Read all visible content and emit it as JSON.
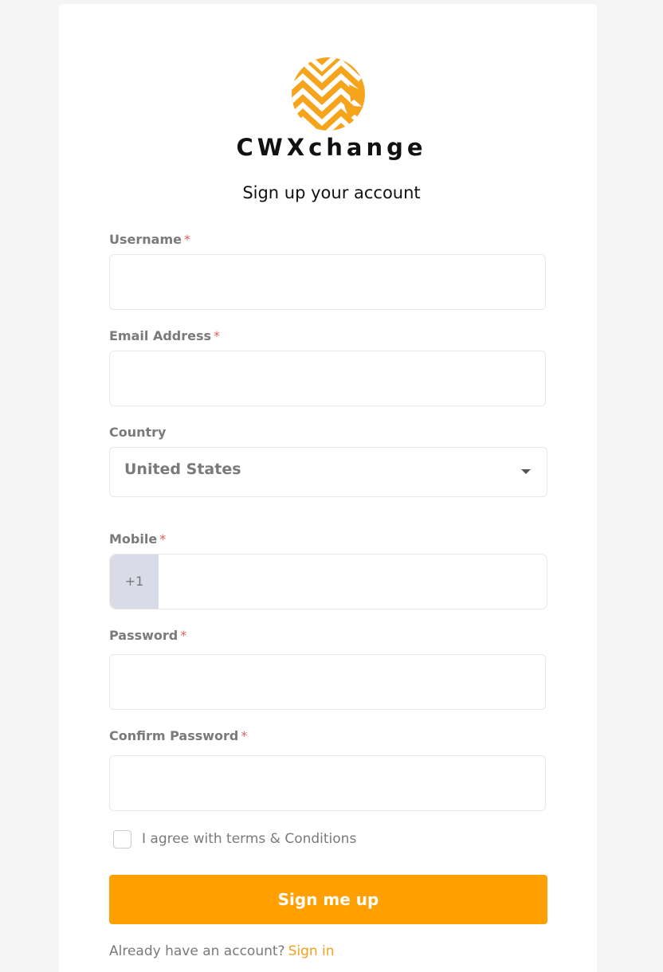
{
  "brand": {
    "name": "CWXchange",
    "logo_icon": "chevron-arrows-circle-logo",
    "logo_color": "#F5A41C"
  },
  "heading": "Sign up your account",
  "form": {
    "username": {
      "label": "Username",
      "required_mark": "*",
      "value": ""
    },
    "email": {
      "label": "Email Address",
      "required_mark": "*",
      "value": ""
    },
    "country": {
      "label": "Country",
      "selected": "United States"
    },
    "mobile": {
      "label": "Mobile",
      "required_mark": "*",
      "prefix": "+1",
      "value": ""
    },
    "password": {
      "label": "Password",
      "required_mark": "*",
      "value": ""
    },
    "confirm_password": {
      "label": "Confirm Password",
      "required_mark": "*",
      "value": ""
    },
    "terms": {
      "label": "I agree with terms & Conditions",
      "checked": false
    },
    "submit_label": "Sign me up"
  },
  "footer": {
    "prompt": "Already have an account?",
    "link": "Sign in"
  },
  "colors": {
    "accent": "#FFA000",
    "link": "#F1A11E",
    "required": "#E25C5C"
  }
}
